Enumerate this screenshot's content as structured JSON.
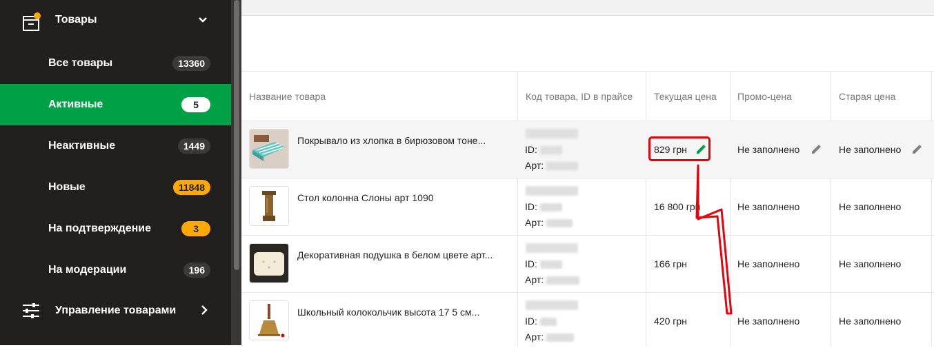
{
  "sidebar": {
    "header": {
      "label": "Товары"
    },
    "items": [
      {
        "label": "Все товары",
        "count": "13360",
        "badge_style": "dark"
      },
      {
        "label": "Активные",
        "count": "5",
        "badge_style": "white",
        "active": true
      },
      {
        "label": "Неактивные",
        "count": "1449",
        "badge_style": "dark"
      },
      {
        "label": "Новые",
        "count": "11848",
        "badge_style": "orange"
      },
      {
        "label": "На подтверждение",
        "count": "3",
        "badge_style": "orange"
      },
      {
        "label": "На модерации",
        "count": "196",
        "badge_style": "dark"
      }
    ],
    "manage": {
      "label": "Управление товарами"
    }
  },
  "table": {
    "columns": [
      "Название товара",
      "Код товара, ID в прайсе",
      "Текущая цена",
      "Промо-цена",
      "Старая цена"
    ],
    "id_label": "ID:",
    "art_label": "Арт:",
    "rows": [
      {
        "name": "Покрывало из хлопка в бирюзовом тоне...",
        "price": "829 грн",
        "promo": "Не заполнено",
        "old": "Не заполнено",
        "highlighted": true
      },
      {
        "name": "Стол колонна Слоны арт 1090",
        "price": "16 800 грн",
        "promo": "Не заполнено",
        "old": "Не заполнено"
      },
      {
        "name": "Декоративная подушка в белом цвете арт...",
        "price": "166 грн",
        "promo": "Не заполнено",
        "old": "Не заполнено"
      },
      {
        "name": "Школьный колокольчик высота 17 5 см...",
        "price": "420 грн",
        "promo": "Не заполнено",
        "old": "Не заполнено"
      }
    ]
  },
  "colors": {
    "sidebar_bg": "#221f1f",
    "active_green": "#00a046",
    "badge_orange": "#ffa900",
    "annotation_red": "#e8000b",
    "edit_green": "#00a046"
  }
}
